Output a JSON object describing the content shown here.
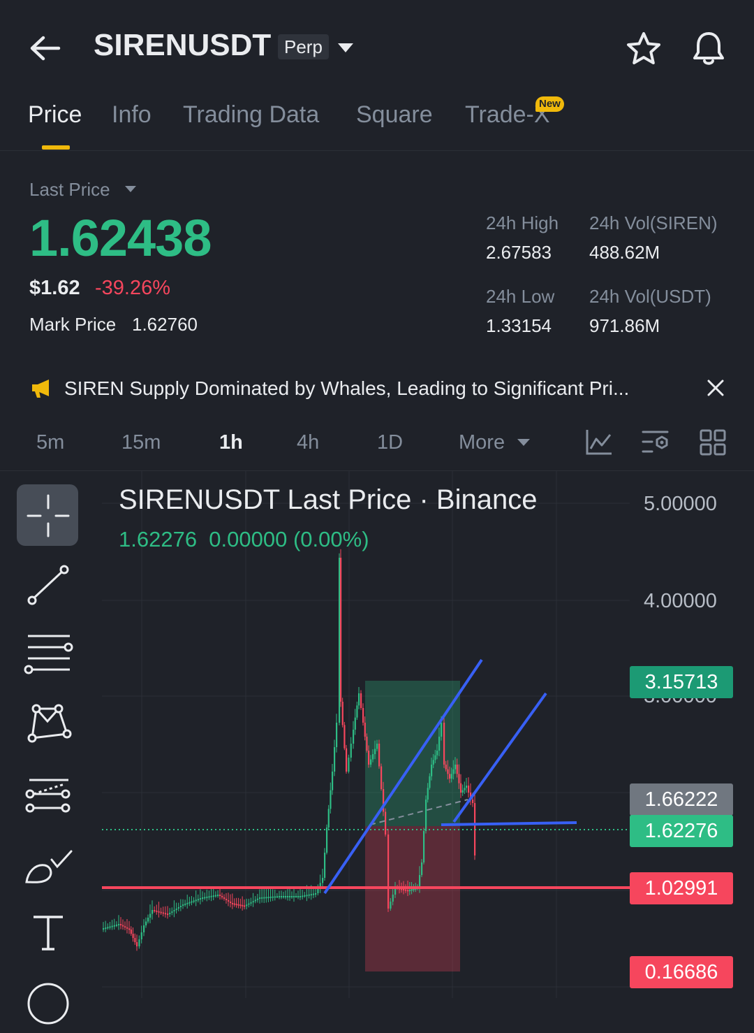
{
  "header": {
    "symbol": "SIRENUSDT",
    "badge": "Perp",
    "icons": [
      "back-arrow-icon",
      "chevron-down-icon",
      "star-icon",
      "bell-icon"
    ]
  },
  "tabs": [
    {
      "label": "Price",
      "active": true
    },
    {
      "label": "Info"
    },
    {
      "label": "Trading Data"
    },
    {
      "label": "Square"
    },
    {
      "label": "Trade-X",
      "badge": "New"
    }
  ],
  "price": {
    "label": "Last Price",
    "value": "1.62438",
    "usd": "$1.62",
    "change": "-39.26%",
    "mark_label": "Mark Price",
    "mark_value": "1.62760"
  },
  "stats": {
    "high_label": "24h High",
    "high_value": "2.67583",
    "low_label": "24h Low",
    "low_value": "1.33154",
    "vol_base_label": "24h Vol(SIREN)",
    "vol_base_value": "488.62M",
    "vol_quote_label": "24h Vol(USDT)",
    "vol_quote_value": "971.86M"
  },
  "news": {
    "text": "SIREN Supply Dominated by Whales, Leading to Significant Pri..."
  },
  "intervals": [
    {
      "label": "5m"
    },
    {
      "label": "15m"
    },
    {
      "label": "1h",
      "active": true
    },
    {
      "label": "4h"
    },
    {
      "label": "1D"
    },
    {
      "label": "More"
    }
  ],
  "chart": {
    "title": "SIRENUSDT Last Price · Binance",
    "last": "1.62276",
    "change": "0.00000 (0.00%)",
    "y_labels": [
      "5.00000",
      "4.00000",
      "3.00000"
    ],
    "tags": {
      "target": "3.15713",
      "entry": "1.66222",
      "current": "1.62276",
      "line_level": "1.02991",
      "stop": "0.16686"
    },
    "colors": {
      "up": "#2ebd85",
      "down": "#f6465d",
      "trend": "#3860f5",
      "accent": "#f0b90b"
    }
  },
  "tools": [
    "crosshair-icon",
    "trendline-icon",
    "horizontal-lines-icon",
    "pattern-icon",
    "projection-icon",
    "brush-icon",
    "text-icon",
    "shape-icon"
  ]
}
